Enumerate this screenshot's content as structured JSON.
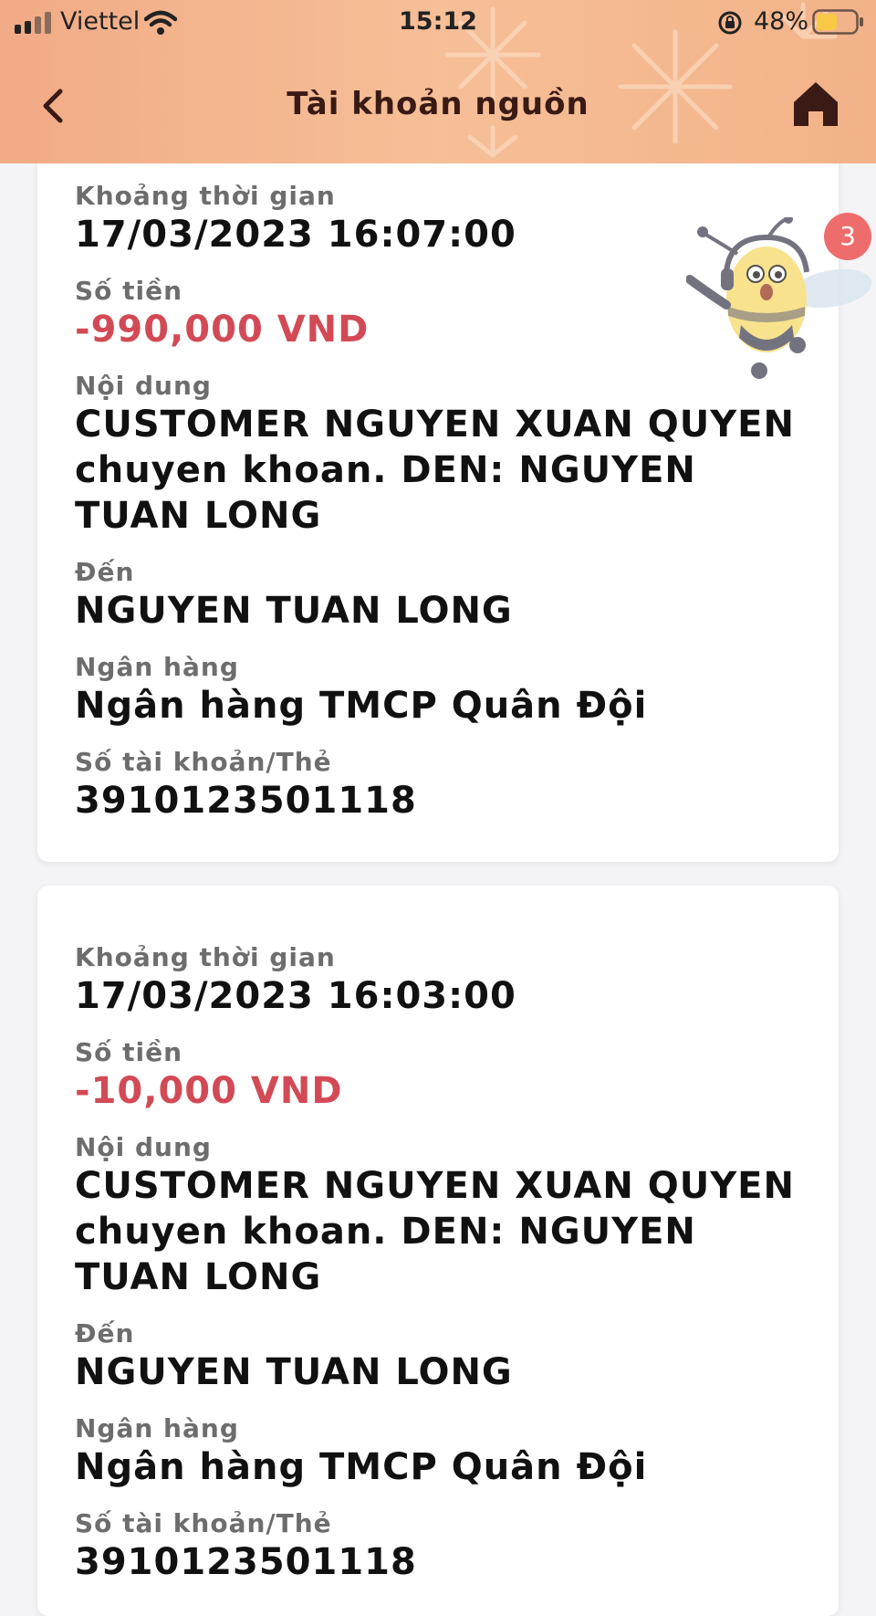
{
  "status_bar": {
    "carrier": "Viettel",
    "time": "15:12",
    "battery_percent": "48%"
  },
  "header": {
    "title": "Tài khoản nguồn",
    "back_icon": "chevron-left-icon",
    "home_icon": "home-icon"
  },
  "colors": {
    "header_bg": "#f3b289",
    "amount_negative": "#d24a55",
    "badge": "#ee6c6c"
  },
  "assistant": {
    "badge_count": "3"
  },
  "transactions": [
    {
      "time_label": "Khoảng thời gian",
      "time": "17/03/2023 16:07:00",
      "amount_label": "Số tiền",
      "amount": "-990,000 VND",
      "content_label": "Nội dung",
      "content": "CUSTOMER NGUYEN XUAN QUYEN chuyen khoan. DEN: NGUYEN TUAN LONG",
      "to_label": "Đến",
      "to": "NGUYEN TUAN LONG",
      "bank_label": "Ngân hàng",
      "bank": "Ngân hàng TMCP Quân Đội",
      "account_label": "Số tài khoản/Thẻ",
      "account": "3910123501118"
    },
    {
      "time_label": "Khoảng thời gian",
      "time": "17/03/2023 16:03:00",
      "amount_label": "Số tiền",
      "amount": "-10,000 VND",
      "content_label": "Nội dung",
      "content": "CUSTOMER NGUYEN XUAN QUYEN chuyen khoan. DEN: NGUYEN TUAN LONG",
      "to_label": "Đến",
      "to": "NGUYEN TUAN LONG",
      "bank_label": "Ngân hàng",
      "bank": "Ngân hàng TMCP Quân Đội",
      "account_label": "Số tài khoản/Thẻ",
      "account": "3910123501118"
    }
  ]
}
